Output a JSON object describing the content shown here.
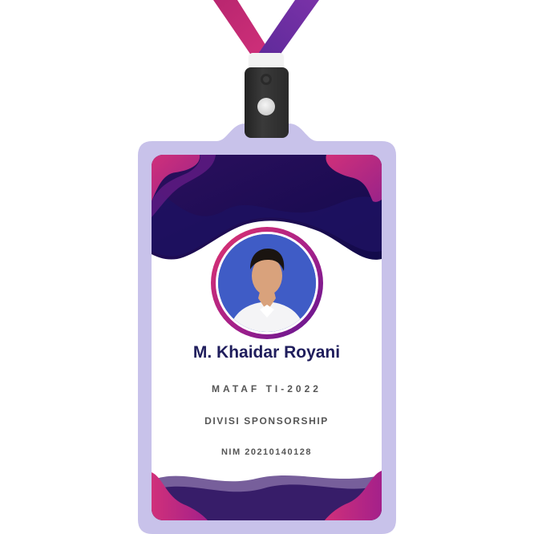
{
  "card": {
    "name": "M. Khaidar Royani",
    "class": "MATAF TI-2022",
    "division": "DIVISI SPONSORSHIP",
    "nim": "NIM 20210140128"
  },
  "colors": {
    "lanyard_left": "#c42a6f",
    "lanyard_right": "#6a2fa0",
    "holder": "#c8c2ea",
    "wave_dark": "#1b0f52",
    "wave_pink": "#d0307a",
    "name_text": "#1f1d5c",
    "label_text": "#555555"
  },
  "icons": [
    "id-card-clip-icon"
  ]
}
